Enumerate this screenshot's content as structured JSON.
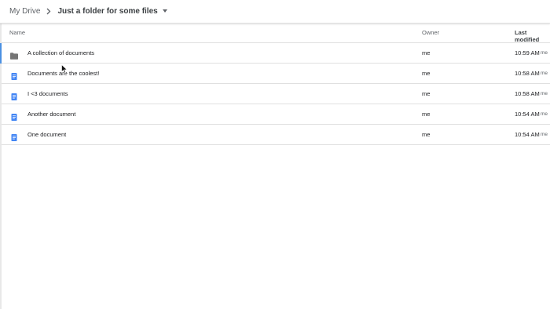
{
  "breadcrumb": {
    "root": "My Drive",
    "current": "Just a folder for some files"
  },
  "columns": {
    "name": "Name",
    "owner": "Owner",
    "last_modified": "Last modified"
  },
  "rows": [
    {
      "name": "A collection of documents",
      "type": "folder",
      "icon": "folder-icon",
      "owner": "me",
      "modified": "10:59 AM",
      "modified_by": "me",
      "selected": true
    },
    {
      "name": "Documents are the coolest!",
      "type": "document",
      "icon": "google-doc-icon",
      "owner": "me",
      "modified": "10:58 AM",
      "modified_by": "me"
    },
    {
      "name": "I <3 documents",
      "type": "document",
      "icon": "google-doc-icon",
      "owner": "me",
      "modified": "10:58 AM",
      "modified_by": "me"
    },
    {
      "name": "Another document",
      "type": "document",
      "icon": "google-doc-icon",
      "owner": "me",
      "modified": "10:54 AM",
      "modified_by": "me"
    },
    {
      "name": "One document",
      "type": "document",
      "icon": "google-doc-icon",
      "owner": "me",
      "modified": "10:54 AM",
      "modified_by": "me"
    }
  ],
  "colors": {
    "folder": "#757575",
    "document": "#4285f4",
    "selection_accent": "#4a90e2"
  }
}
